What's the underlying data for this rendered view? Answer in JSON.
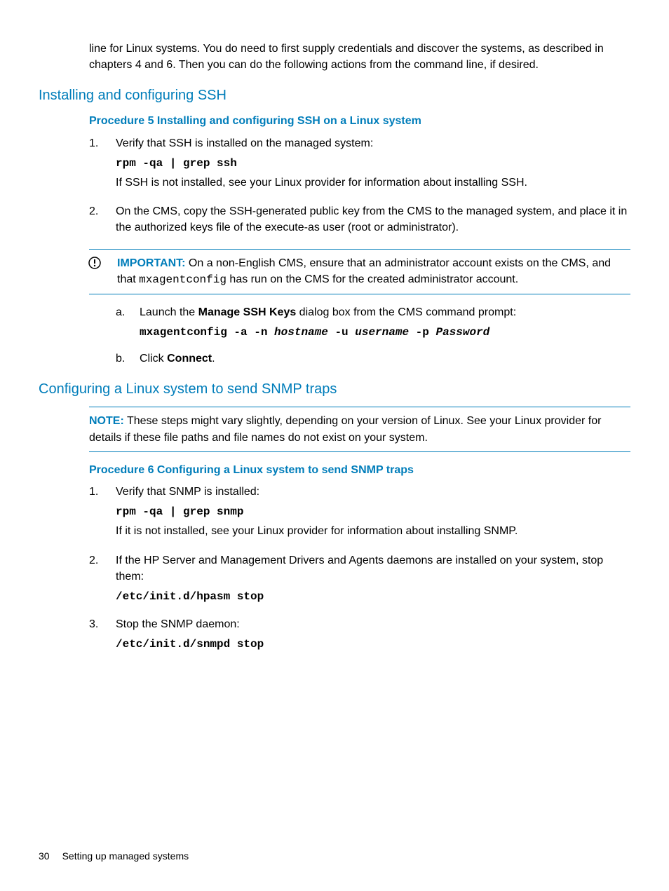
{
  "intro": "line for Linux systems. You do need to first supply credentials and discover the systems, as described in chapters 4 and 6. Then you can do the following actions from the command line, if desired.",
  "section1": {
    "heading": "Installing and configuring SSH",
    "procedure_title": "Procedure 5 Installing and configuring SSH on a Linux system",
    "step1": {
      "num": "1.",
      "text": "Verify that SSH is installed on the managed system:",
      "code": "rpm -qa | grep ssh",
      "after": "If SSH is not installed, see your Linux provider for information about installing SSH."
    },
    "step2": {
      "num": "2.",
      "text": "On the CMS, copy the SSH-generated public key from the CMS to the managed system, and place it in the authorized keys file of the execute-as user (root or administrator)."
    },
    "important": {
      "label": "IMPORTANT:",
      "text_before": "On a non-English CMS, ensure that an administrator account exists on the CMS, and that ",
      "code": "mxagentconfig",
      "text_after": " has run on the CMS for the created administrator account."
    },
    "sub_a": {
      "num": "a.",
      "text_before": "Launch the ",
      "bold": "Manage SSH Keys",
      "text_after": " dialog box from the CMS command prompt:",
      "code_p1": "mxagentconfig -a -n ",
      "code_i1": "hostname",
      "code_p2": " -u ",
      "code_i2": "username",
      "code_p3": " -p ",
      "code_i3": "Password"
    },
    "sub_b": {
      "num": "b.",
      "text_before": "Click ",
      "bold": "Connect",
      "text_after": "."
    }
  },
  "section2": {
    "heading": "Configuring a Linux system to send SNMP traps",
    "note": {
      "label": "NOTE:",
      "text": "These steps might vary slightly, depending on your version of Linux. See your Linux provider for details if these file paths and file names do not exist on your system."
    },
    "procedure_title": "Procedure 6 Configuring a Linux system to send SNMP traps",
    "step1": {
      "num": "1.",
      "text": "Verify that SNMP is installed:",
      "code": "rpm -qa | grep snmp",
      "after": "If it is not installed, see your Linux provider for information about installing SNMP."
    },
    "step2": {
      "num": "2.",
      "text": "If the HP Server and Management Drivers and Agents daemons are installed on your system, stop them:",
      "code": "/etc/init.d/hpasm stop"
    },
    "step3": {
      "num": "3.",
      "text": "Stop the SNMP daemon:",
      "code": "/etc/init.d/snmpd stop"
    }
  },
  "footer": {
    "page": "30",
    "title": "Setting up managed systems"
  }
}
